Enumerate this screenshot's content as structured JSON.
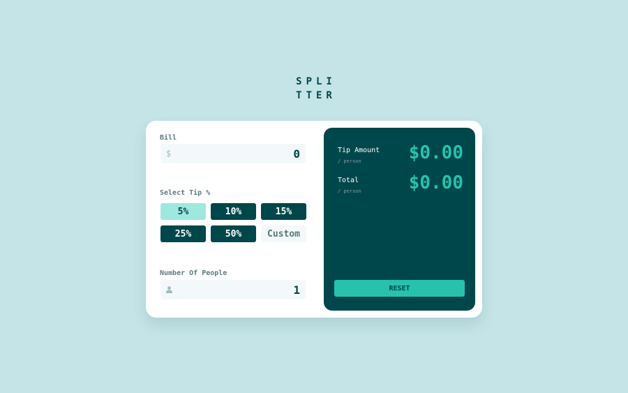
{
  "logo": {
    "line1": "SPLI",
    "line2": "TTER"
  },
  "bill": {
    "label": "Bill",
    "currency_icon": "$",
    "value": "0"
  },
  "tip": {
    "label": "Select Tip %",
    "options": [
      "5%",
      "10%",
      "15%",
      "25%",
      "50%"
    ],
    "selected": "5%",
    "custom_placeholder": "Custom"
  },
  "people": {
    "label": "Number Of People",
    "value": "1",
    "icon": "person-icon"
  },
  "results": {
    "tip_amount": {
      "title": "Tip Amount",
      "subtitle": "/ person",
      "value": "$0.00"
    },
    "total": {
      "title": "Total",
      "subtitle": "/ person",
      "value": "$0.00"
    },
    "reset_label": "RESET"
  },
  "colors": {
    "background": "#c5e4e7",
    "dark_cyan": "#00474b",
    "strong_cyan": "#26c2ae",
    "light_cyan_selected": "#9fe8df",
    "input_bg": "#f3f9fa"
  }
}
